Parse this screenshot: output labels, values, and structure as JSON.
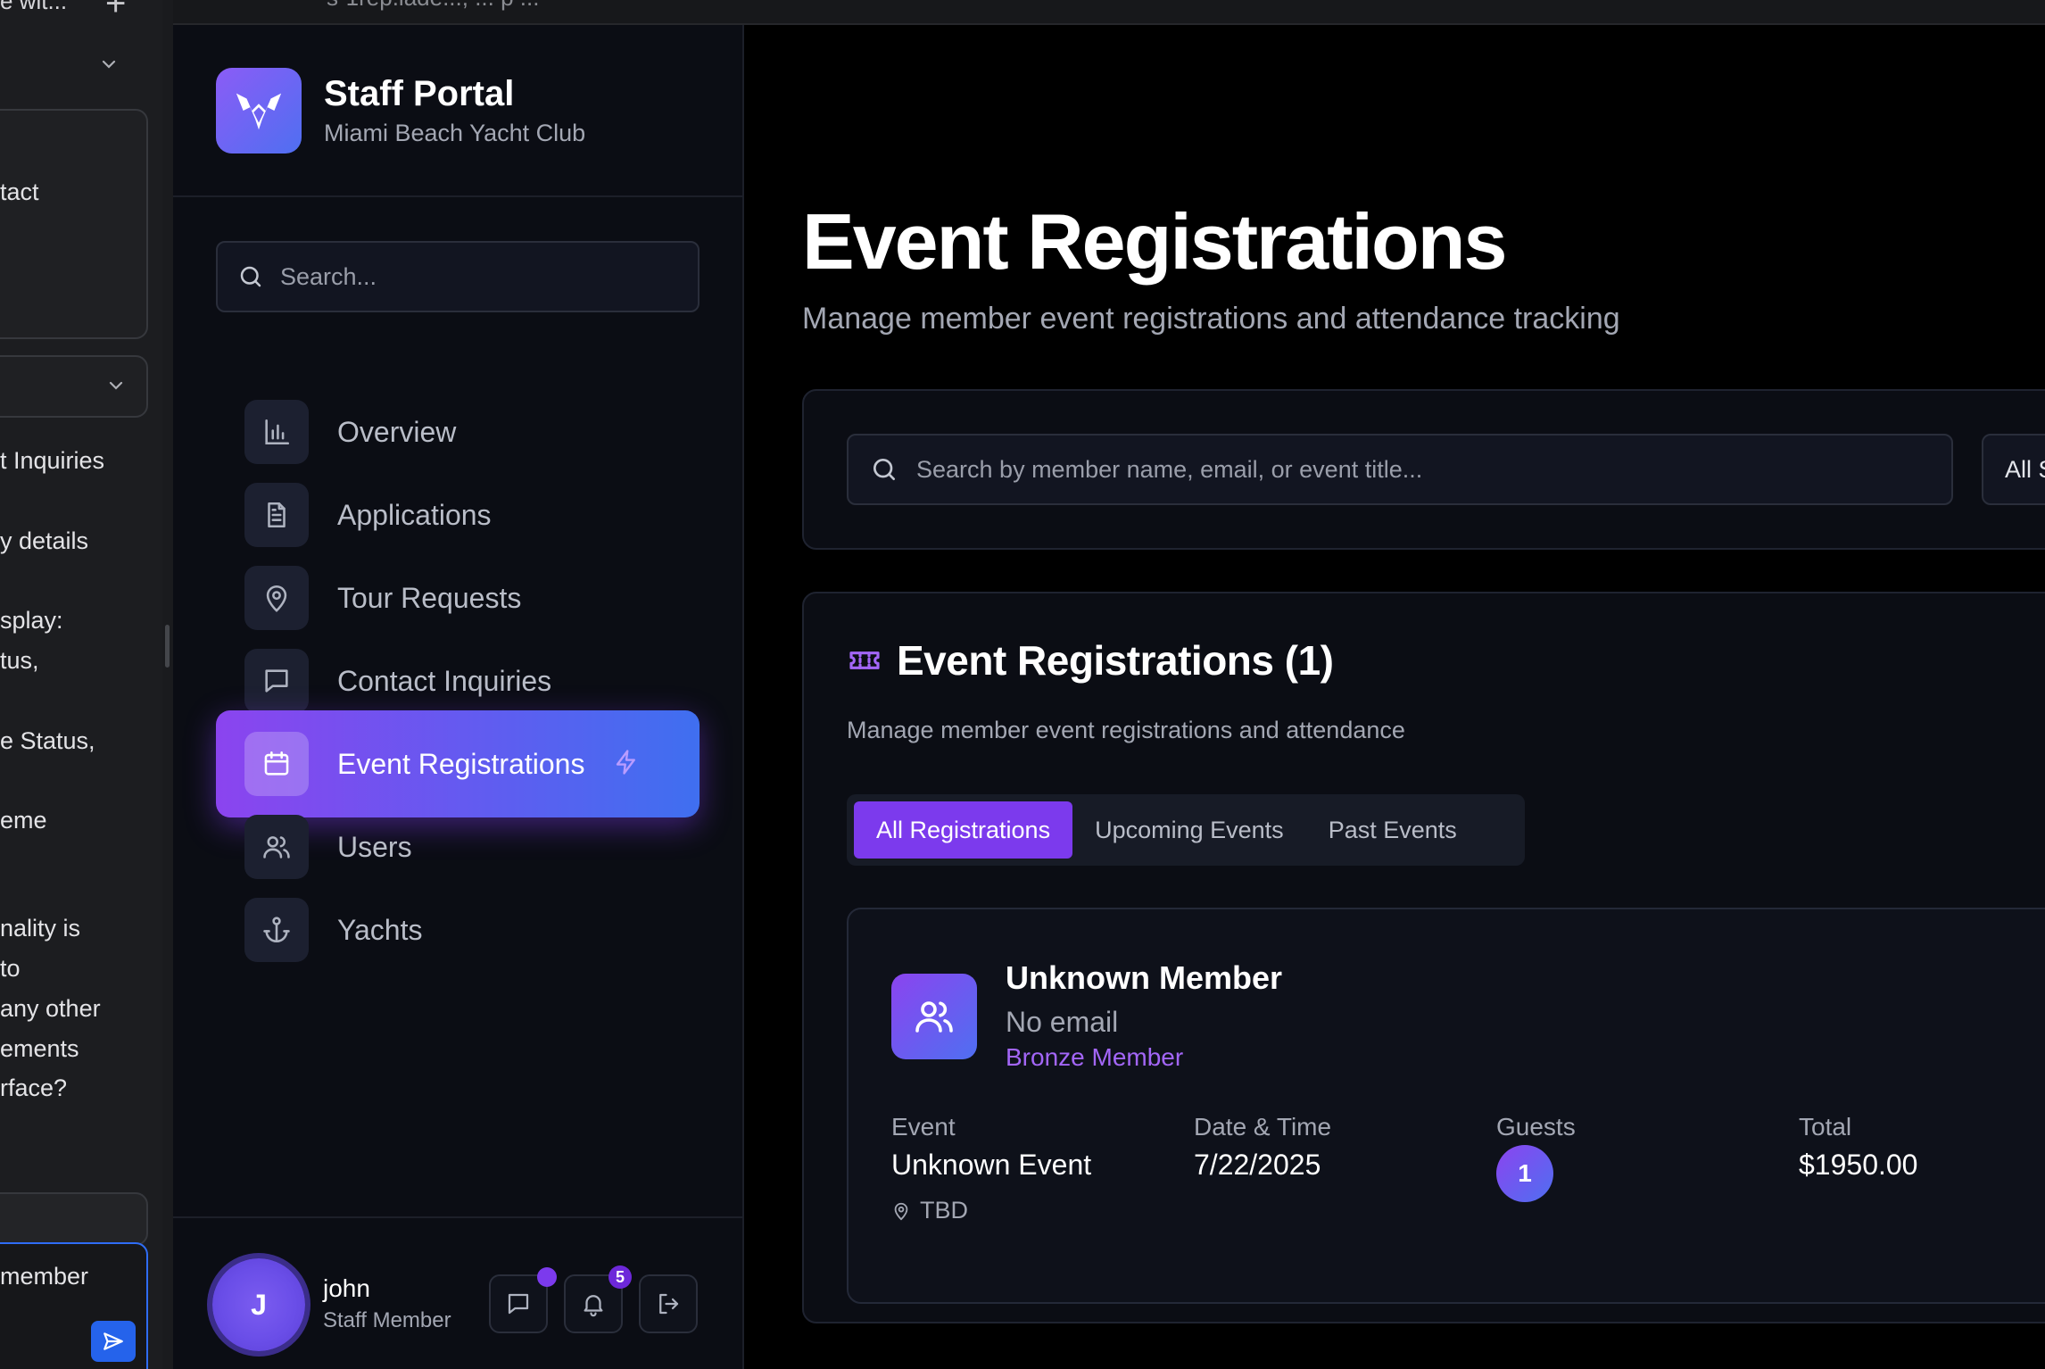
{
  "chat_panel": {
    "top_title": "e wit...",
    "lines": [
      "tact",
      "t Inquiries",
      "y details",
      "splay:",
      "tus,",
      "e Status,",
      "eme",
      "nality is",
      " to",
      "any other",
      "ements",
      "rface?"
    ],
    "input_text": " member"
  },
  "browser": {
    "url": "s-1rep.iade..., ... p ..."
  },
  "sidebar": {
    "brand_title": "Staff Portal",
    "brand_subtitle": "Miami Beach Yacht Club",
    "search_placeholder": "Search...",
    "items": [
      {
        "label": "Overview",
        "icon": "bar-chart-icon"
      },
      {
        "label": "Applications",
        "icon": "document-icon"
      },
      {
        "label": "Tour Requests",
        "icon": "map-pin-icon"
      },
      {
        "label": "Contact Inquiries",
        "icon": "message-icon"
      },
      {
        "label": "Event Registrations",
        "icon": "calendar-icon",
        "active": true
      },
      {
        "label": "Users",
        "icon": "users-icon"
      },
      {
        "label": "Yachts",
        "icon": "anchor-icon"
      }
    ],
    "user": {
      "initial": "J",
      "name": "john",
      "role": "Staff Member"
    },
    "notification_count": "5"
  },
  "main": {
    "title": "Event Registrations",
    "subtitle": "Manage member event registrations and attendance tracking",
    "filter": {
      "search_placeholder": "Search by member name, email, or event title...",
      "status_select": "All Status"
    },
    "list": {
      "title": "Event Registrations (1)",
      "subtitle": "Manage member event registrations and attendance",
      "tabs": [
        "All Registrations",
        "Upcoming Events",
        "Past Events"
      ],
      "active_tab": "All Registrations"
    },
    "registration": {
      "member_name": "Unknown Member",
      "member_email": "No email",
      "member_tier": "Bronze Member",
      "labels": {
        "event": "Event",
        "datetime": "Date & Time",
        "guests": "Guests",
        "total": "Total"
      },
      "event_name": "Unknown Event",
      "location": "TBD",
      "date": "7/22/2025",
      "guests": "1",
      "total": "$1950.00"
    }
  },
  "colors": {
    "accent_purple": "#7c3aed",
    "accent_blue": "#3f6ff0",
    "tier_text": "#a366f7",
    "background": "#000000",
    "card": "#0b0d14"
  }
}
